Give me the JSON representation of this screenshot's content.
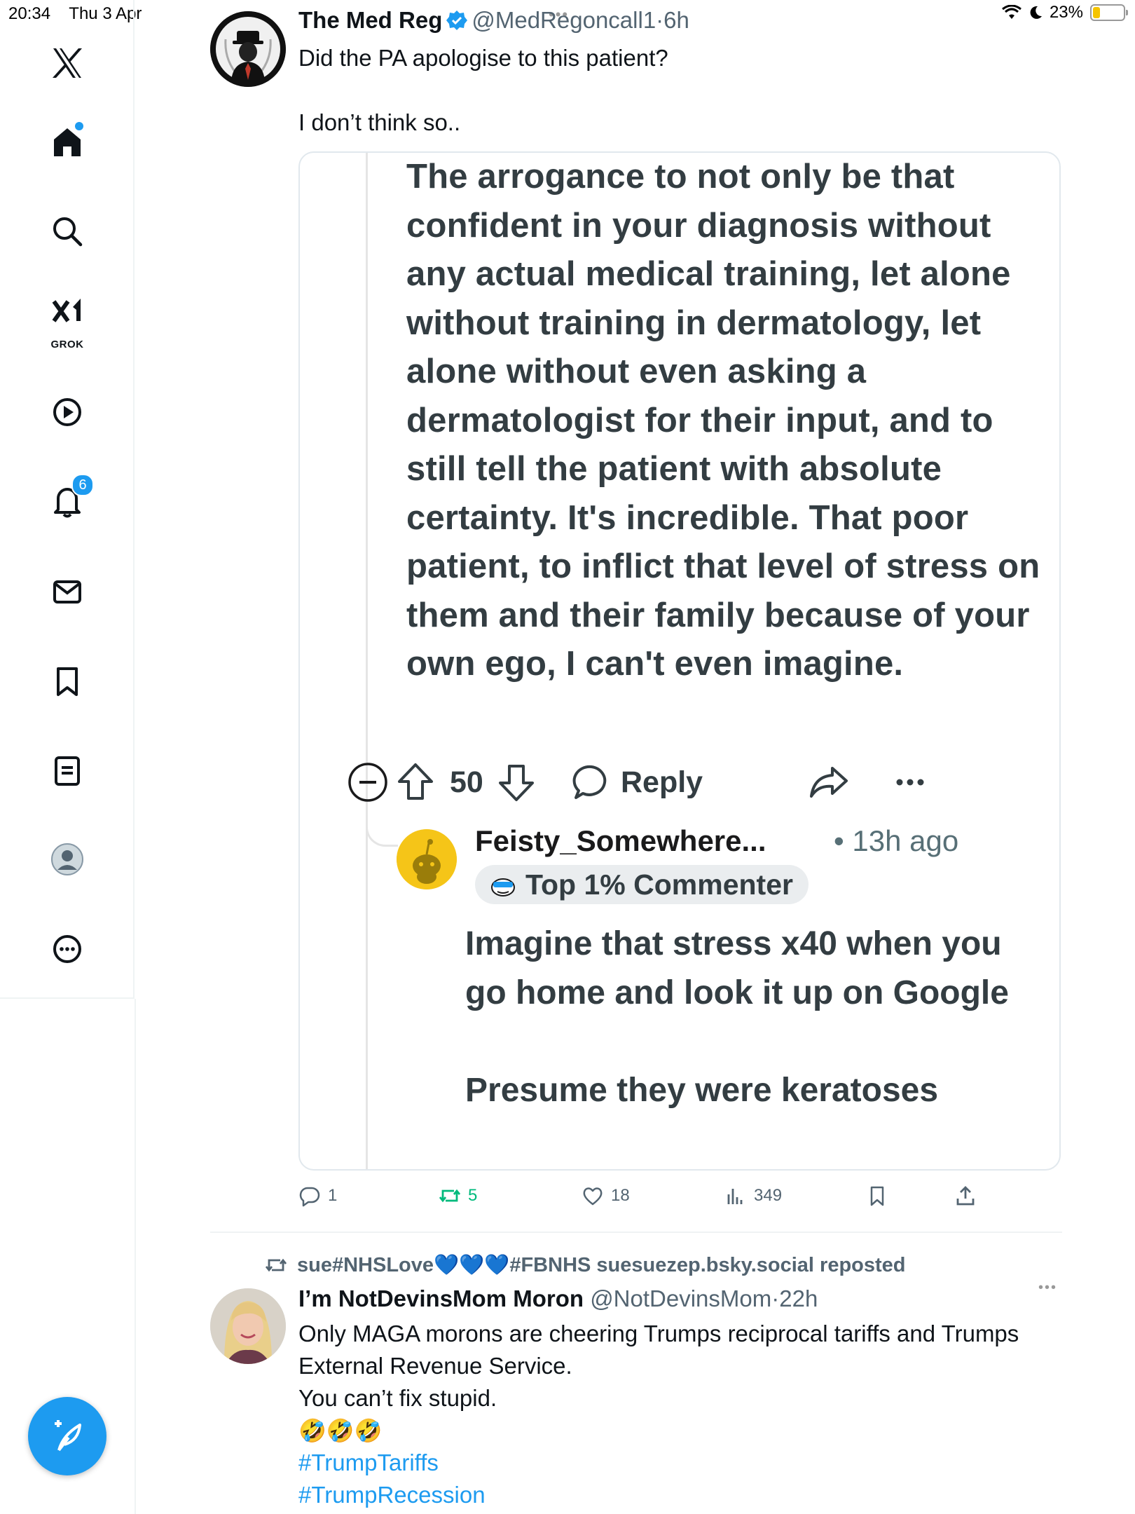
{
  "status_bar": {
    "time": "20:34",
    "date": "Thu 3 Apr",
    "battery": "23%",
    "battery_fraction": 0.23
  },
  "sidebar": {
    "items": [
      {
        "name": "x-logo",
        "label": ""
      },
      {
        "name": "home",
        "label": ""
      },
      {
        "name": "search",
        "label": ""
      },
      {
        "name": "grok",
        "label": "GROK"
      },
      {
        "name": "videos",
        "label": ""
      },
      {
        "name": "notifications",
        "label": "",
        "badge": "6"
      },
      {
        "name": "messages",
        "label": ""
      },
      {
        "name": "bookmarks",
        "label": ""
      },
      {
        "name": "lists",
        "label": ""
      },
      {
        "name": "profile",
        "label": ""
      },
      {
        "name": "more",
        "label": ""
      }
    ]
  },
  "tweet1": {
    "display_name": "The Med Reg",
    "handle": "@MedRegoncall1",
    "separator": "·",
    "time": "6h",
    "text": "Did the PA apologise to this patient?\n\nI don’t think so..",
    "quoted": {
      "comment_text": "The arrogance to not only be that confident in your diagnosis without any actual medical training, let alone without training in dermatology, let alone without even asking a dermatologist for their input, and to still tell the patient with absolute certainty. It's incredible. That poor patient, to inflict that level of stress on them and their family because of your own ego, I can't even imagine.",
      "votes": "50",
      "reply_label": "Reply",
      "reply": {
        "username": "Feisty_Somewhere...",
        "time": "• 13h ago",
        "flair": "Top 1% Commenter",
        "body": [
          "Imagine that stress x40 when you go home and look it up on Google",
          "Presume they were keratoses"
        ]
      }
    },
    "actions": {
      "replies": "1",
      "reposts": "5",
      "likes": "18",
      "views": "349"
    }
  },
  "tweet2": {
    "reposted_by": "sue#NHSLove💙💙💙#FBNHS suesuezep.bsky.social reposted",
    "display_name": "I’m NotDevinsMom Moron",
    "handle": "@NotDevinsMom",
    "separator": "·",
    "time": "22h",
    "lines": [
      "Only MAGA morons are cheering Trumps reciprocal tariffs and Trumps External Revenue Service.",
      "You can’t fix stupid.",
      "🤣🤣🤣"
    ],
    "hashtags": [
      "#TrumpTariffs",
      "#TrumpRecession"
    ]
  },
  "colors": {
    "accent": "#1d9bf0",
    "repost_active": "#00ba7c",
    "text": "#0f1419",
    "secondary": "#536471",
    "reddit_text": "#333d42"
  }
}
